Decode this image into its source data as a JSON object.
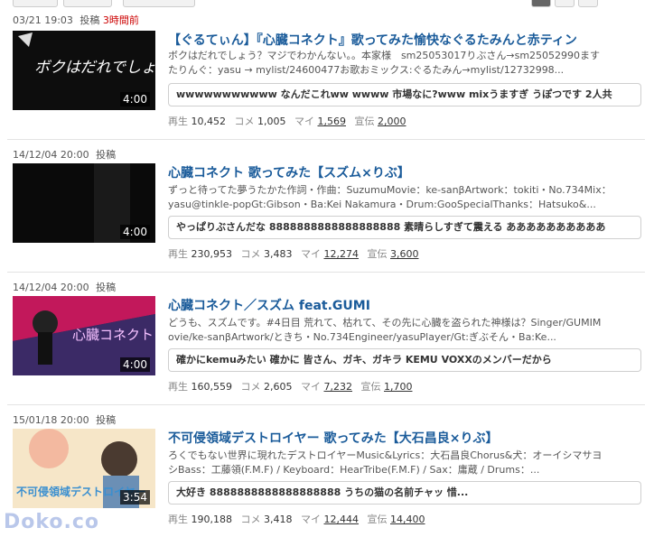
{
  "items": [
    {
      "date": "03/21 19:03",
      "posted": "投稿",
      "ago": "3時間前",
      "duration": "4:00",
      "thumb_text": "ボクはだれでしょう?",
      "title": "【ぐるてぃん】『心臓コネクト』歌ってみた愉快なぐるたみんと赤ティン",
      "desc1": "ボクはだれでしょう？マジでわかんない。。本家様　sm25053017りぶさん→sm25052990ます",
      "desc2": "たりんぐ：yasu → mylist/24600477お歌おミックス:ぐるたみん→mylist/12732998...",
      "comment": "wwwwwwwwwww なんだこれww wwww 市場なに?www mixうますぎ うぽつです 2人共",
      "views_label": "再生",
      "views": "10,452",
      "comments_label": "コメ",
      "comments": "1,005",
      "mylist_label": "マイ",
      "mylist": "1,569",
      "ad_label": "宣伝",
      "ad": "2,000"
    },
    {
      "date": "14/12/04 20:00",
      "posted": "投稿",
      "ago": "",
      "duration": "4:00",
      "thumb_text": "",
      "title": "心臓コネクト 歌ってみた【スズム×りぶ】",
      "desc1": "ずっと待ってた夢うたかた作詞・作曲：SuzumuMovie：ke-sanβArtwork：tokiti・No.734Mix：",
      "desc2": "yasu@tinkle-popGt:Gibson・Ba:Kei Nakamura・Drum:GooSpecialThanks：Hatsuko&...",
      "comment": "やっぱりぶさんだな 8888888888888888888 素晴らしすぎて震える ああああああああああ",
      "views_label": "再生",
      "views": "230,953",
      "comments_label": "コメ",
      "comments": "3,483",
      "mylist_label": "マイ",
      "mylist": "12,274",
      "ad_label": "宣伝",
      "ad": "3,600"
    },
    {
      "date": "14/12/04 20:00",
      "posted": "投稿",
      "ago": "",
      "duration": "4:00",
      "thumb_text": "心臓コネクト",
      "title": "心臓コネクト／スズム feat.GUMI",
      "desc1": "どうも、スズムです。#4日目 荒れて、枯れて、その先に心臓を盗られた神様は？Singer/GUMIM",
      "desc2": "ovie/ke-sanβArtwork/ときち・No.734Engineer/yasuPlayer/Gt:ぎぶそん・Ba:Ke...",
      "comment": "確かにkemuみたい 確かに 皆さん、ガキ、ガキラ KEMU VOXXのメンバーだから",
      "views_label": "再生",
      "views": "160,559",
      "comments_label": "コメ",
      "comments": "2,605",
      "mylist_label": "マイ",
      "mylist": "7,232",
      "ad_label": "宣伝",
      "ad": "1,700"
    },
    {
      "date": "15/01/18 20:00",
      "posted": "投稿",
      "ago": "",
      "duration": "3:54",
      "thumb_text": "不可侵領域デストロイヤー",
      "title": "不可侵領域デストロイヤー 歌ってみた【大石昌良×りぶ】",
      "desc1": "ろくでもない世界に現れたデストロイヤーMusic&Lyrics：大石昌良Chorus&犬：オーイシマサヨ",
      "desc2": "シBass：工藤領(F.M.F) / Keyboard：HearTribe(F.M.F) / Sax：庸蔵 / Drums：...",
      "comment": "大好き 8888888888888888888 うちの猫の名前チャッ 惜...",
      "views_label": "再生",
      "views": "190,188",
      "comments_label": "コメ",
      "comments": "3,418",
      "mylist_label": "マイ",
      "mylist": "12,444",
      "ad_label": "宣伝",
      "ad": "14,400"
    }
  ],
  "watermark": "Doko.co",
  "colors": {
    "title": "#1a5b9a",
    "ago": "#cc0000"
  }
}
